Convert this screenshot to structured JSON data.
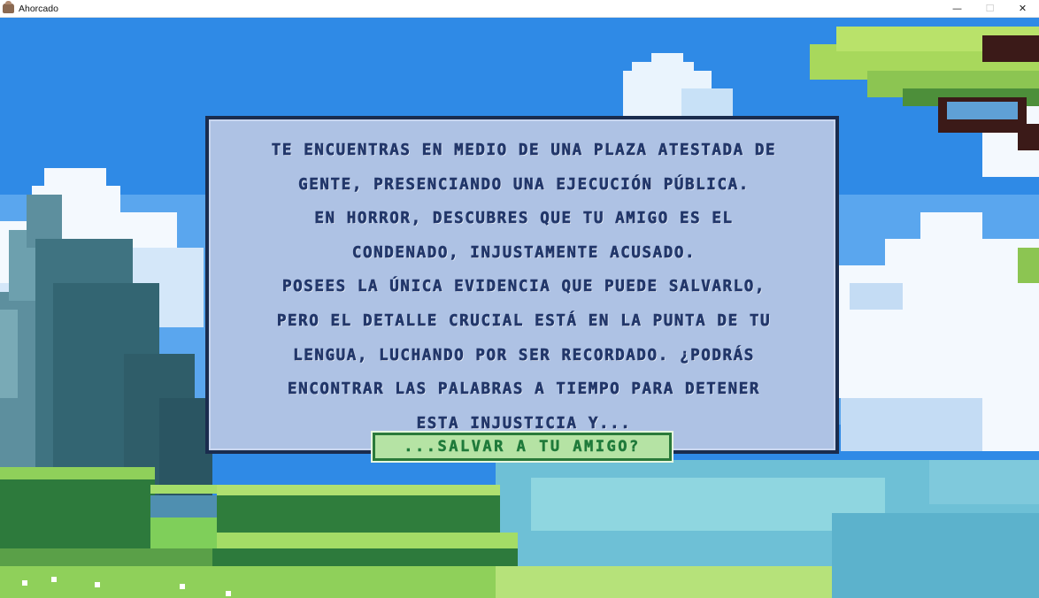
{
  "window": {
    "title": "Ahorcado",
    "minimize_glyph": "—",
    "maximize_glyph": "☐",
    "close_glyph": "✕"
  },
  "story": {
    "text": "Te encuentras en medio de una plaza atestada de\ngente, presenciando una ejecución pública.\nEn horror, descubres que tu amigo es el\ncondenado, injustamente acusado.\nPosees la única evidencia que puede salvarlo,\npero el detalle crucial está en la punta de tu\nlengua, luchando por ser recordado. ¿Podrás\nencontrar las palabras a tiempo para detener\nesta injusticia y...",
    "continue_label": "...salvar a tu amigo?"
  },
  "colors": {
    "sky": "#2f8ae6",
    "panel_bg": "#aec2e4",
    "panel_border": "#1a2c4e",
    "text": "#22376a",
    "button_bg": "#b5e3a4",
    "button_text": "#1f7a3a"
  },
  "icons": {
    "app": "cake-icon"
  }
}
